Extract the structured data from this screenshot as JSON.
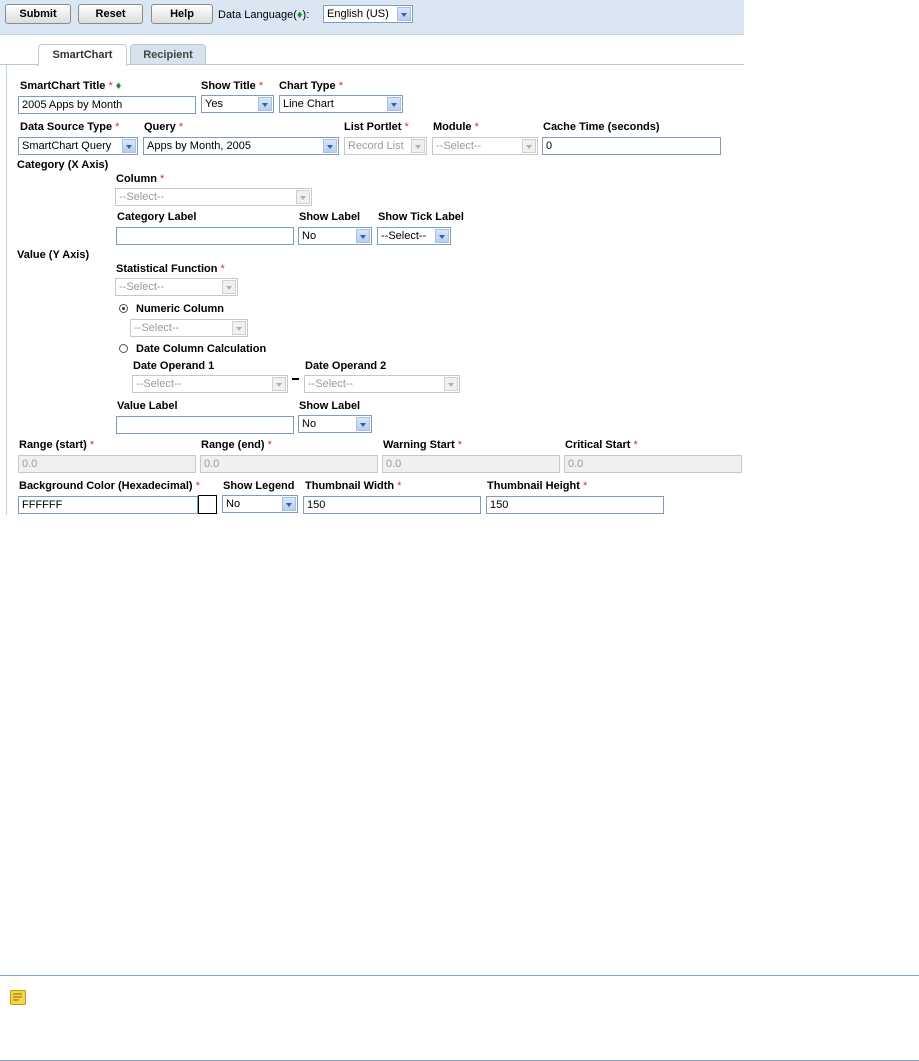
{
  "toolbar": {
    "submit_label": "Submit",
    "reset_label": "Reset",
    "help_label": "Help",
    "language_label_prefix": "Data Language(",
    "language_label_diamond": "♦",
    "language_label_suffix": "):",
    "language_value": "English (US)"
  },
  "tabs": [
    {
      "label": "SmartChart"
    },
    {
      "label": "Recipient"
    }
  ],
  "form": {
    "smartchart_title": {
      "label": "SmartChart Title",
      "value": "2005 Apps by Month"
    },
    "show_title": {
      "label": "Show Title",
      "value": "Yes"
    },
    "chart_type": {
      "label": "Chart Type",
      "value": "Line Chart"
    },
    "data_source_type": {
      "label": "Data Source Type",
      "value": "SmartChart Query"
    },
    "query": {
      "label": "Query",
      "value": "Apps by Month, 2005"
    },
    "list_portlet": {
      "label": "List Portlet",
      "value": "Record List"
    },
    "module": {
      "label": "Module",
      "value": "--Select--"
    },
    "cache_time": {
      "label": "Cache Time (seconds)",
      "value": "0"
    },
    "category_section": "Category (X Axis)",
    "column": {
      "label": "Column",
      "value": "--Select--"
    },
    "category_label": {
      "label": "Category Label",
      "value": ""
    },
    "category_show_label": {
      "label": "Show Label",
      "value": "No"
    },
    "show_tick_label": {
      "label": "Show Tick Label",
      "value": "--Select--"
    },
    "value_section": "Value (Y Axis)",
    "statistical_function": {
      "label": "Statistical Function",
      "value": "--Select--"
    },
    "numeric_column": {
      "label": "Numeric Column",
      "value": "--Select--"
    },
    "date_column_calc": {
      "label": "Date Column Calculation"
    },
    "date_operand_1": {
      "label": "Date Operand 1",
      "value": "--Select--"
    },
    "date_operand_2": {
      "label": "Date Operand 2",
      "value": "--Select--"
    },
    "value_label": {
      "label": "Value Label",
      "value": ""
    },
    "value_show_label": {
      "label": "Show Label",
      "value": "No"
    },
    "range_start": {
      "label": "Range (start)",
      "value": "0.0"
    },
    "range_end": {
      "label": "Range (end)",
      "value": "0.0"
    },
    "warning_start": {
      "label": "Warning Start",
      "value": "0.0"
    },
    "critical_start": {
      "label": "Critical Start",
      "value": "0.0"
    },
    "background_color": {
      "label": "Background Color (Hexadecimal)",
      "value": "FFFFFF",
      "swatch": "#FFFFFF"
    },
    "show_legend": {
      "label": "Show Legend",
      "value": "No"
    },
    "thumbnail_width": {
      "label": "Thumbnail Width",
      "value": "150"
    },
    "thumbnail_height": {
      "label": "Thumbnail Height",
      "value": "150"
    },
    "required_mark": "*"
  },
  "colors": {
    "toolbar_bg": "#dae7f3",
    "required": "#d03030",
    "translatable_diamond": "#1c8a2e",
    "note_rule": "#7aa6c9"
  },
  "icons": {
    "note": "note-icon",
    "dropdown": "chevron-down-icon",
    "translatable": "diamond-icon"
  }
}
